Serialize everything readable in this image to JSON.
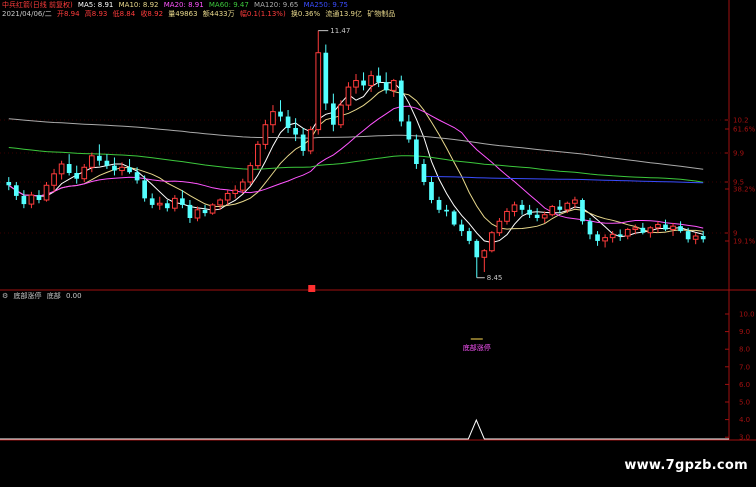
{
  "header": {
    "stock_name": "中兵红箭(日线 前复权)",
    "ma5": "MA5: 8.91",
    "ma10": "MA10: 8.92",
    "ma20": "MA20: 8.91",
    "ma60": "MA60: 9.47",
    "ma120": "MA120: 9.65",
    "ma250": "MA250: 9.75"
  },
  "quote": {
    "date": "2021/04/06/二",
    "open": "开8.94",
    "high": "高8.93",
    "low": "低8.84",
    "close": "收8.92",
    "volume": "量49863",
    "amount": "额4433万",
    "change": "幅0.1(1.13%)",
    "turnover": "换0.36%",
    "float_cap": "流通13.9亿",
    "industry": "矿物制品"
  },
  "indicator": {
    "name": "底部涨停",
    "label": "底部",
    "value": "0.00",
    "annotation": "底部涨停"
  },
  "watermark": "www.7gpzb.com",
  "colors": {
    "up": "#ff3c3c",
    "down": "#54ffff",
    "ma5": "#ffffff",
    "ma10": "#e8d88c",
    "ma20": "#ff55ff",
    "ma60": "#3cc83c",
    "ma120": "#aaaaaa",
    "ma250": "#3a4dff",
    "axis": "#a01010",
    "marker": "#ff3030"
  },
  "chart_data": {
    "type": "candlestick",
    "price_ticks": [
      "10.2",
      "61.6%",
      "9.9",
      "38.2%",
      "9.5",
      "19.1%",
      "9"
    ],
    "indicator_ticks": [
      "10.0",
      "9.0",
      "8.0",
      "7.0",
      "6.0",
      "5.0",
      "4.0",
      "3.0"
    ],
    "ylim": [
      8.3,
      11.6
    ],
    "high_label": "11.47",
    "low_label": "8.45",
    "candles": [
      [
        9.62,
        9.68,
        9.52,
        9.58
      ],
      [
        9.58,
        9.62,
        9.4,
        9.45
      ],
      [
        9.45,
        9.52,
        9.3,
        9.35
      ],
      [
        9.35,
        9.5,
        9.3,
        9.46
      ],
      [
        9.46,
        9.52,
        9.36,
        9.4
      ],
      [
        9.4,
        9.62,
        9.38,
        9.58
      ],
      [
        9.58,
        9.78,
        9.5,
        9.72
      ],
      [
        9.72,
        9.88,
        9.65,
        9.84
      ],
      [
        9.84,
        9.96,
        9.7,
        9.73
      ],
      [
        9.73,
        9.82,
        9.6,
        9.66
      ],
      [
        9.66,
        9.84,
        9.62,
        9.8
      ],
      [
        9.8,
        9.98,
        9.74,
        9.94
      ],
      [
        9.94,
        10.08,
        9.82,
        9.88
      ],
      [
        9.88,
        9.96,
        9.78,
        9.82
      ],
      [
        9.82,
        9.92,
        9.7,
        9.76
      ],
      [
        9.76,
        9.86,
        9.7,
        9.8
      ],
      [
        9.8,
        9.9,
        9.72,
        9.74
      ],
      [
        9.74,
        9.8,
        9.6,
        9.64
      ],
      [
        9.64,
        9.7,
        9.38,
        9.42
      ],
      [
        9.42,
        9.48,
        9.3,
        9.34
      ],
      [
        9.34,
        9.44,
        9.28,
        9.36
      ],
      [
        9.36,
        9.4,
        9.26,
        9.3
      ],
      [
        9.3,
        9.46,
        9.26,
        9.42
      ],
      [
        9.42,
        9.52,
        9.3,
        9.34
      ],
      [
        9.34,
        9.4,
        9.12,
        9.18
      ],
      [
        9.18,
        9.32,
        9.14,
        9.28
      ],
      [
        9.28,
        9.34,
        9.2,
        9.24
      ],
      [
        9.24,
        9.36,
        9.22,
        9.34
      ],
      [
        9.34,
        9.42,
        9.28,
        9.4
      ],
      [
        9.4,
        9.52,
        9.34,
        9.48
      ],
      [
        9.48,
        9.58,
        9.42,
        9.52
      ],
      [
        9.52,
        9.66,
        9.48,
        9.62
      ],
      [
        9.62,
        9.86,
        9.58,
        9.82
      ],
      [
        9.82,
        10.12,
        9.78,
        10.08
      ],
      [
        10.08,
        10.38,
        10.02,
        10.32
      ],
      [
        10.32,
        10.56,
        10.22,
        10.48
      ],
      [
        10.48,
        10.62,
        10.36,
        10.42
      ],
      [
        10.42,
        10.5,
        10.22,
        10.28
      ],
      [
        10.28,
        10.4,
        10.12,
        10.2
      ],
      [
        10.2,
        10.28,
        9.94,
        10.0
      ],
      [
        10.0,
        10.3,
        9.96,
        10.26
      ],
      [
        10.26,
        11.47,
        10.2,
        11.2
      ],
      [
        11.2,
        11.3,
        10.5,
        10.58
      ],
      [
        10.58,
        10.7,
        10.24,
        10.32
      ],
      [
        10.32,
        10.62,
        10.28,
        10.56
      ],
      [
        10.56,
        10.84,
        10.5,
        10.78
      ],
      [
        10.78,
        10.94,
        10.7,
        10.86
      ],
      [
        10.86,
        10.96,
        10.74,
        10.8
      ],
      [
        10.8,
        10.98,
        10.72,
        10.92
      ],
      [
        10.92,
        11.02,
        10.78,
        10.84
      ],
      [
        10.84,
        10.96,
        10.7,
        10.74
      ],
      [
        10.74,
        10.88,
        10.66,
        10.86
      ],
      [
        10.86,
        10.92,
        10.3,
        10.36
      ],
      [
        10.36,
        10.44,
        10.1,
        10.14
      ],
      [
        10.14,
        10.2,
        9.78,
        9.84
      ],
      [
        9.84,
        9.9,
        9.58,
        9.62
      ],
      [
        9.62,
        9.68,
        9.36,
        9.4
      ],
      [
        9.4,
        9.44,
        9.24,
        9.28
      ],
      [
        9.28,
        9.34,
        9.2,
        9.26
      ],
      [
        9.26,
        9.28,
        9.08,
        9.1
      ],
      [
        9.1,
        9.16,
        8.96,
        9.02
      ],
      [
        9.02,
        9.06,
        8.86,
        8.9
      ],
      [
        8.9,
        8.92,
        8.45,
        8.7
      ],
      [
        8.7,
        8.8,
        8.52,
        8.78
      ],
      [
        8.78,
        9.02,
        8.76,
        9.0
      ],
      [
        9.0,
        9.18,
        8.96,
        9.14
      ],
      [
        9.14,
        9.3,
        9.1,
        9.26
      ],
      [
        9.26,
        9.38,
        9.2,
        9.34
      ],
      [
        9.34,
        9.4,
        9.22,
        9.28
      ],
      [
        9.28,
        9.34,
        9.18,
        9.22
      ],
      [
        9.22,
        9.3,
        9.14,
        9.18
      ],
      [
        9.18,
        9.26,
        9.12,
        9.22
      ],
      [
        9.22,
        9.34,
        9.2,
        9.32
      ],
      [
        9.32,
        9.4,
        9.24,
        9.28
      ],
      [
        9.28,
        9.38,
        9.24,
        9.36
      ],
      [
        9.36,
        9.44,
        9.3,
        9.4
      ],
      [
        9.4,
        9.42,
        9.1,
        9.14
      ],
      [
        9.14,
        9.18,
        8.92,
        8.98
      ],
      [
        8.98,
        9.02,
        8.84,
        8.9
      ],
      [
        8.9,
        8.98,
        8.82,
        8.94
      ],
      [
        8.94,
        9.02,
        8.88,
        8.98
      ],
      [
        8.98,
        9.04,
        8.9,
        8.96
      ],
      [
        8.96,
        9.06,
        8.92,
        9.04
      ],
      [
        9.04,
        9.1,
        8.98,
        9.06
      ],
      [
        9.06,
        9.12,
        8.98,
        9.0
      ],
      [
        9.0,
        9.08,
        8.94,
        9.06
      ],
      [
        9.06,
        9.14,
        9.0,
        9.1
      ],
      [
        9.1,
        9.16,
        9.02,
        9.04
      ],
      [
        9.04,
        9.12,
        8.96,
        9.08
      ],
      [
        9.08,
        9.14,
        9.0,
        9.02
      ],
      [
        9.02,
        9.06,
        8.88,
        8.92
      ],
      [
        8.92,
        9.0,
        8.86,
        8.96
      ],
      [
        8.96,
        9.02,
        8.88,
        8.92
      ]
    ]
  }
}
